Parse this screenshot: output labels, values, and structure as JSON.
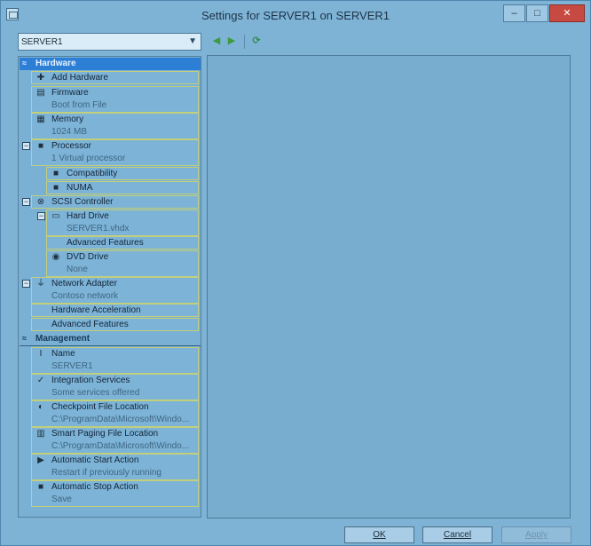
{
  "window": {
    "title": "Settings for SERVER1 on SERVER1",
    "min_label": "–",
    "max_label": "□",
    "close_label": "✕"
  },
  "toolbar": {
    "vm_select_value": "SERVER1",
    "back_glyph": "◀",
    "forward_glyph": "▶",
    "refresh_glyph": "⟳"
  },
  "sidebar": {
    "hardware_header": "Hardware",
    "management_header": "Management",
    "items": {
      "add_hardware": {
        "label": "Add Hardware"
      },
      "firmware": {
        "label": "Firmware",
        "sub": "Boot from File"
      },
      "memory": {
        "label": "Memory",
        "sub": "1024 MB"
      },
      "processor": {
        "label": "Processor",
        "sub": "1 Virtual processor"
      },
      "compatibility": {
        "label": "Compatibility"
      },
      "numa": {
        "label": "NUMA"
      },
      "scsi": {
        "label": "SCSI Controller"
      },
      "hard_drive": {
        "label": "Hard Drive",
        "sub": "SERVER1.vhdx"
      },
      "hd_advanced": {
        "label": "Advanced Features"
      },
      "dvd_drive": {
        "label": "DVD Drive",
        "sub": "None"
      },
      "network_adapter": {
        "label": "Network Adapter",
        "sub": "Contoso network"
      },
      "hw_accel": {
        "label": "Hardware Acceleration"
      },
      "net_advanced": {
        "label": "Advanced Features"
      },
      "name": {
        "label": "Name",
        "sub": "SERVER1"
      },
      "integration": {
        "label": "Integration Services",
        "sub": "Some services offered"
      },
      "checkpoint": {
        "label": "Checkpoint File Location",
        "sub": "C:\\ProgramData\\Microsoft\\Windo..."
      },
      "smart_paging": {
        "label": "Smart Paging File Location",
        "sub": "C:\\ProgramData\\Microsoft\\Windo..."
      },
      "auto_start": {
        "label": "Automatic Start Action",
        "sub": "Restart if previously running"
      },
      "auto_stop": {
        "label": "Automatic Stop Action",
        "sub": "Save"
      }
    }
  },
  "footer": {
    "ok": "OK",
    "cancel": "Cancel",
    "apply": "Apply"
  }
}
